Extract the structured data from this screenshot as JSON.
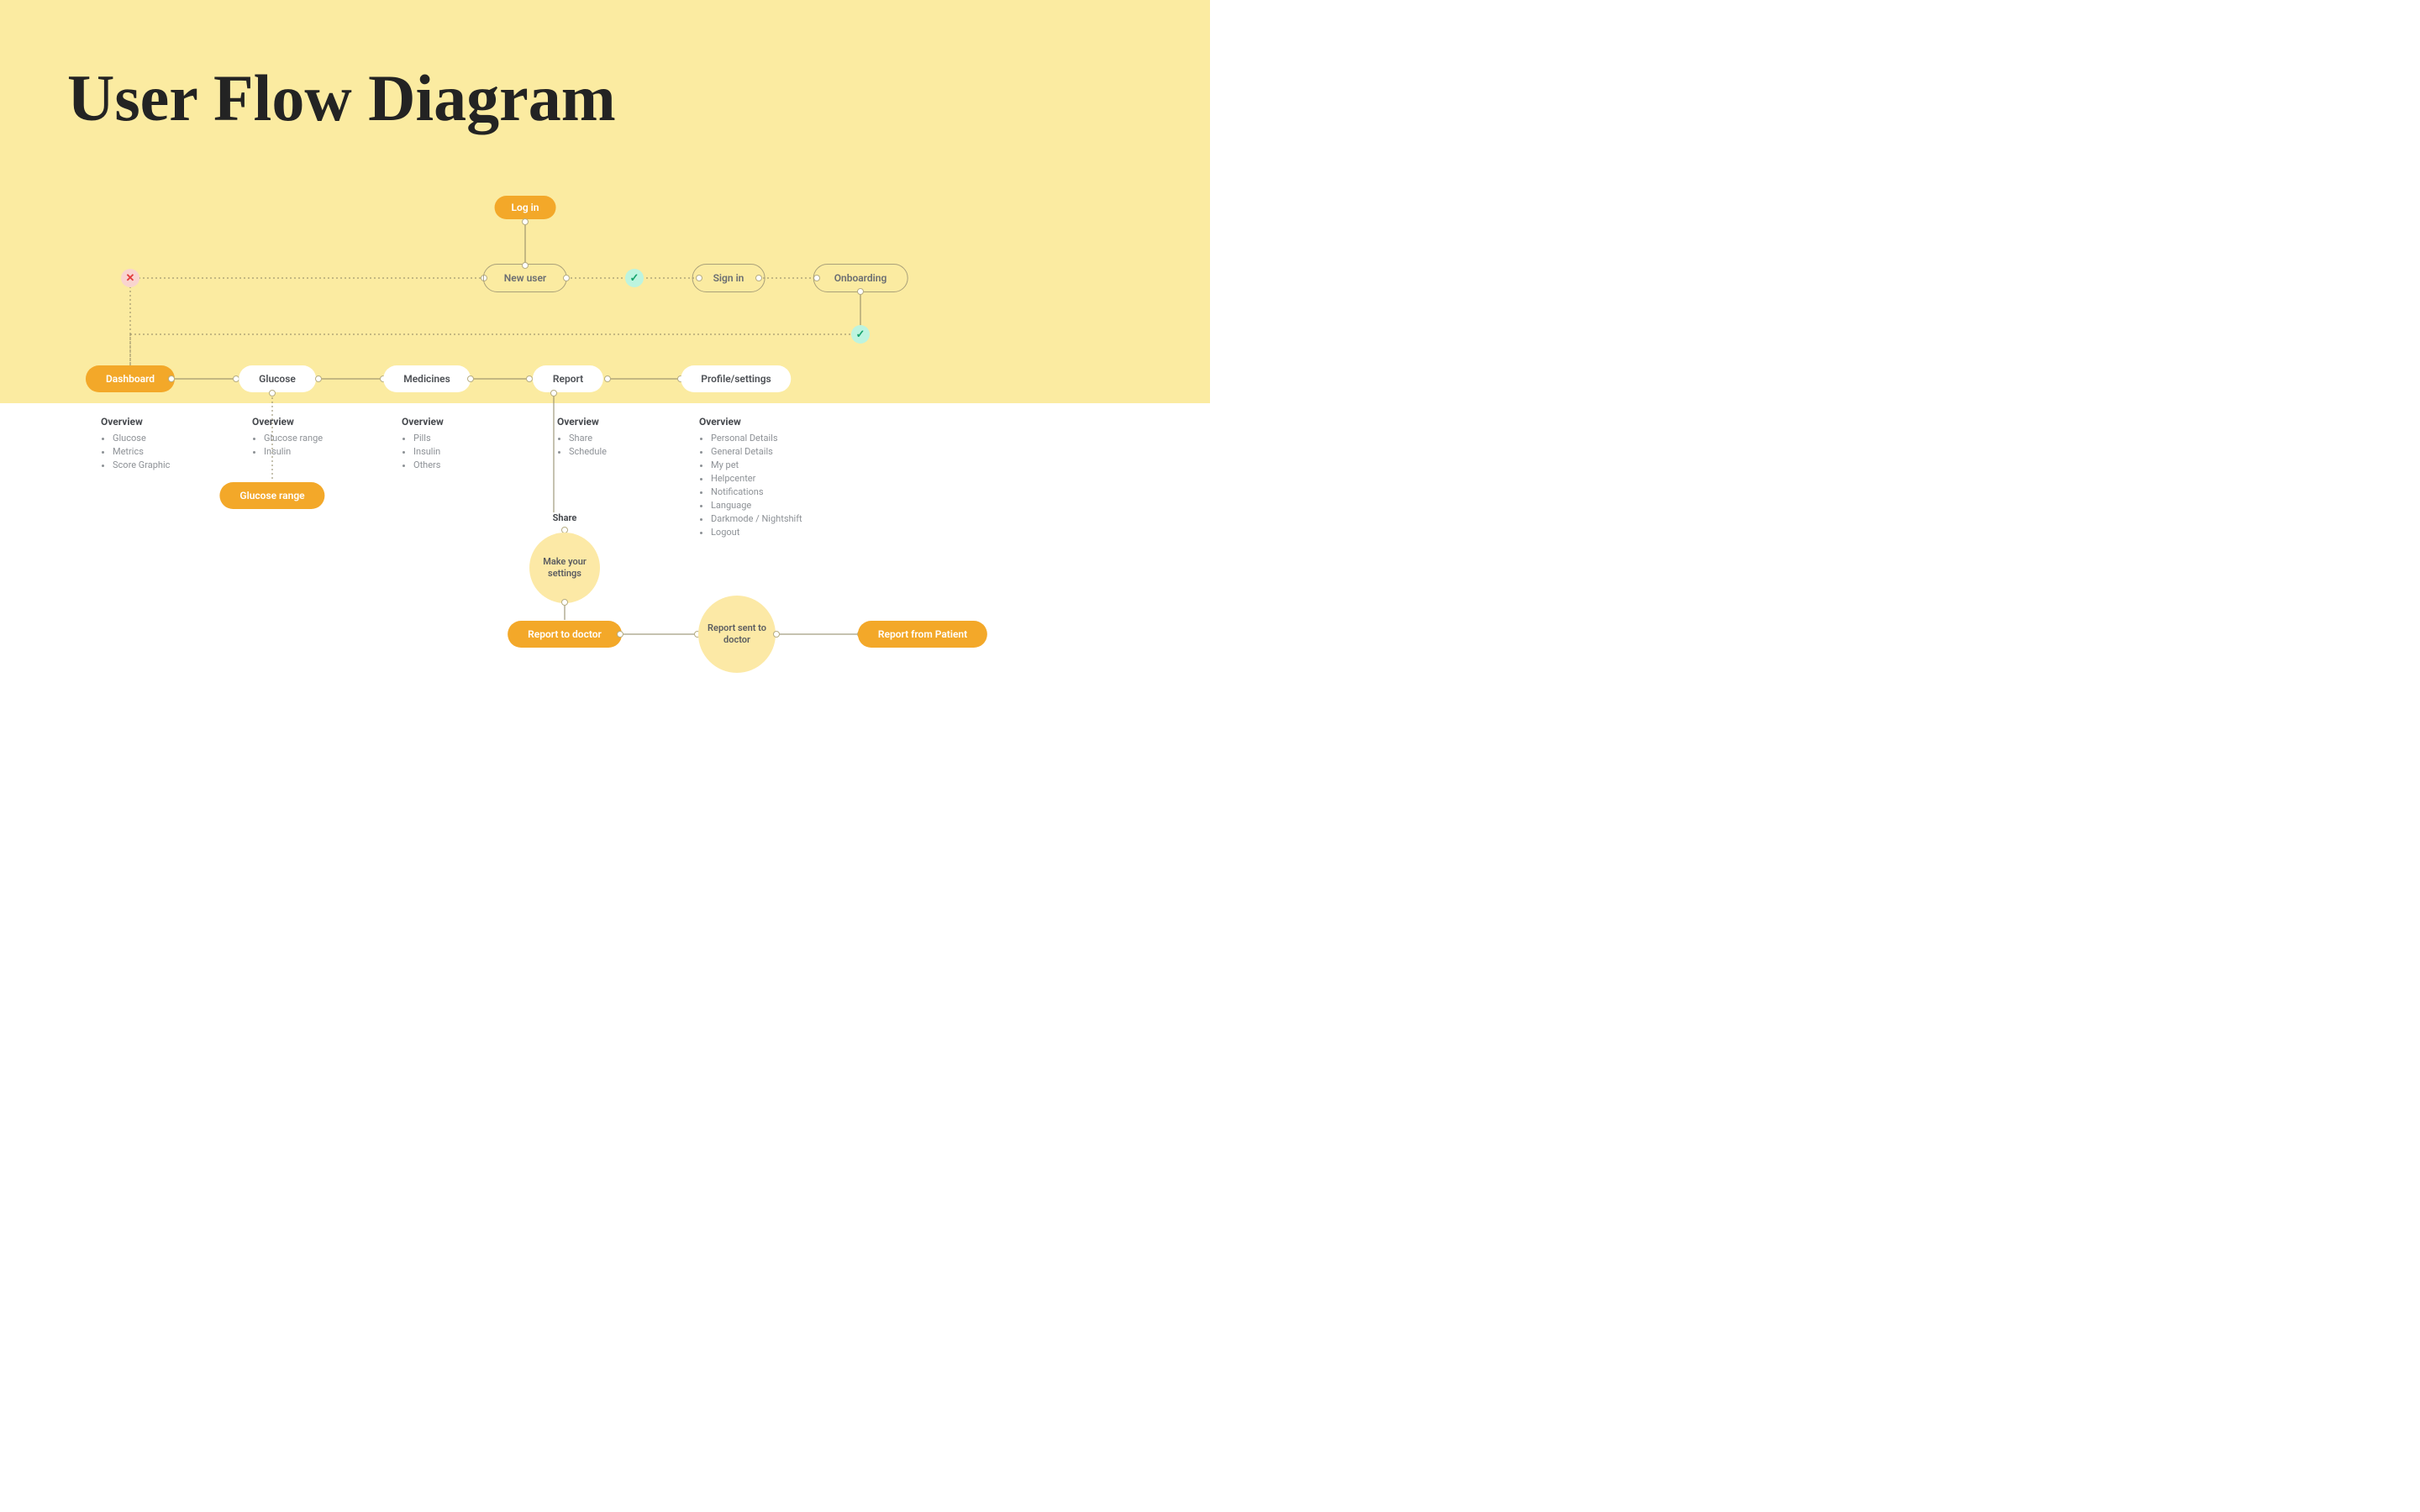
{
  "title": "User Flow Diagram",
  "nodes": {
    "login": "Log in",
    "newuser": "New user",
    "signin": "Sign in",
    "onboarding": "Onboarding",
    "dashboard": "Dashboard",
    "glucose": "Glucose",
    "medicines": "Medicines",
    "report": "Report",
    "profile": "Profile/settings",
    "glucoseRange": "Glucose range",
    "share": "Share",
    "makeSettings": "Make your settings",
    "reportDoctor": "Report to doctor",
    "reportSent": "Report sent to doctor",
    "reportFromPatient": "Report from Patient"
  },
  "lists": {
    "dashboard": {
      "title": "Overview",
      "items": [
        "Glucose",
        "Metrics",
        "Score Graphic"
      ]
    },
    "glucose": {
      "title": "Overview",
      "items": [
        "Glucose range",
        "Insulin"
      ]
    },
    "medicines": {
      "title": "Overview",
      "items": [
        "Pills",
        "Insulin",
        "Others"
      ]
    },
    "report": {
      "title": "Overview",
      "items": [
        "Share",
        "Schedule"
      ]
    },
    "profile": {
      "title": "Overview",
      "items": [
        "Personal Details",
        "General Details",
        "My pet",
        "Helpcenter",
        "Notifications",
        "Language",
        "Darkmode / Nightshift",
        "Logout"
      ]
    }
  },
  "icons": {
    "check": "✓",
    "cross": "✕"
  }
}
